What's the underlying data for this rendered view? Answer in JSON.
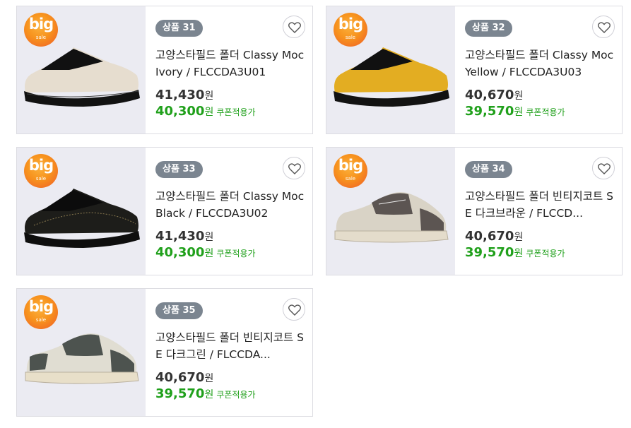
{
  "badge": {
    "big": "big",
    "sale": "sale"
  },
  "units": {
    "won": "원"
  },
  "coupon_label": "쿠폰적용가",
  "products": [
    {
      "number": "상품 31",
      "title": "고양스타필드 폴더 Classy Moc Ivory / FLCCDA3U01",
      "price": "41,430",
      "sale_price": "40,300",
      "colorway": "ivory"
    },
    {
      "number": "상품 32",
      "title": "고양스타필드 폴더 Classy Moc Yellow / FLCCDA3U03",
      "price": "40,670",
      "sale_price": "39,570",
      "colorway": "yellow"
    },
    {
      "number": "상품 33",
      "title": "고양스타필드 폴더 Classy Moc Black / FLCCDA3U02",
      "price": "41,430",
      "sale_price": "40,300",
      "colorway": "black"
    },
    {
      "number": "상품 34",
      "title": "고양스타필드 폴더 빈티지코트 SE 다크브라운 / FLCCD...",
      "price": "40,670",
      "sale_price": "39,570",
      "colorway": "dark-brown"
    },
    {
      "number": "상품 35",
      "title": "고양스타필드 폴더 빈티지코트 SE 다크그린 / FLCCDA...",
      "price": "40,670",
      "sale_price": "39,570",
      "colorway": "dark-green"
    }
  ],
  "colors": {
    "accent_green": "#20a01b",
    "badge_orange": "#f7931e",
    "number_pill": "#7b8590"
  }
}
